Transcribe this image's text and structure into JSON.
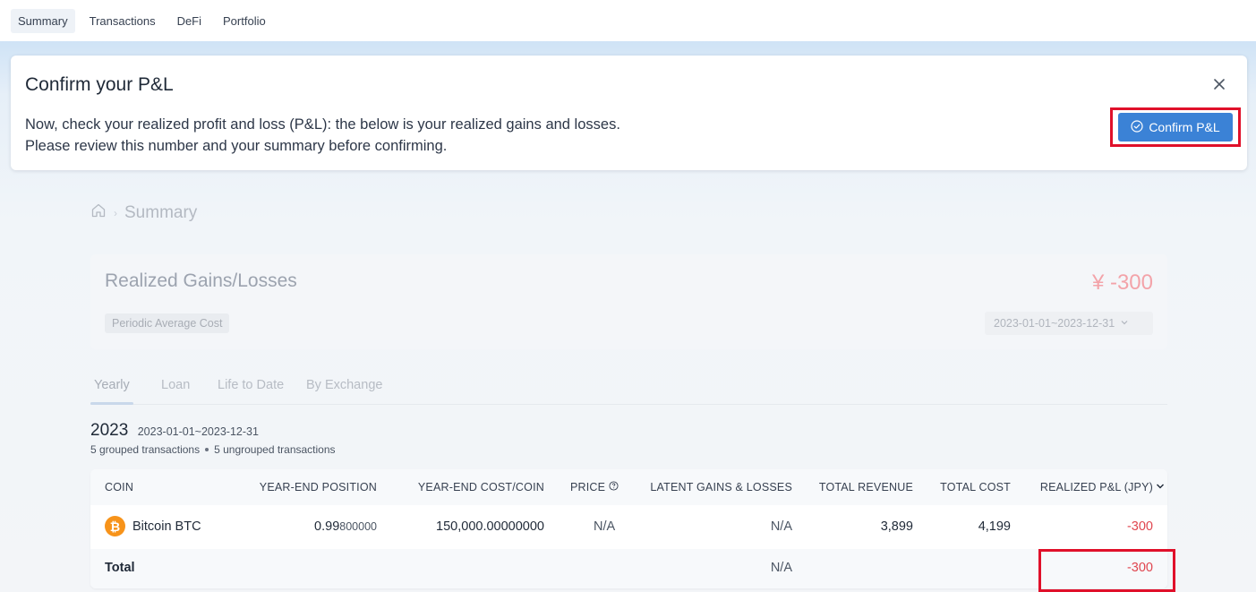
{
  "nav": {
    "tabs": [
      {
        "label": "Summary",
        "active": true
      },
      {
        "label": "Transactions",
        "active": false
      },
      {
        "label": "DeFi",
        "active": false
      },
      {
        "label": "Portfolio",
        "active": false
      }
    ]
  },
  "banner": {
    "title": "Confirm your P&L",
    "line1": "Now, check your realized profit and loss (P&L): the below is your realized gains and losses.",
    "line2": "Please review this number and your summary before confirming.",
    "confirm_label": "Confirm P&L",
    "close_icon": "close-icon"
  },
  "breadcrumb": {
    "home_icon": "home-icon",
    "current": "Summary"
  },
  "gains": {
    "title": "Realized Gains/Losses",
    "value": "¥ -300",
    "method": "Periodic Average Cost",
    "date_range": "2023-01-01~2023-12-31"
  },
  "subtabs": [
    {
      "label": "Yearly",
      "active": true
    },
    {
      "label": "Loan",
      "active": false
    },
    {
      "label": "Life to Date",
      "active": false
    },
    {
      "label": "By Exchange",
      "active": false
    }
  ],
  "year": {
    "year": "2023",
    "range": "2023-01-01~2023-12-31",
    "grouped": "5 grouped transactions",
    "ungrouped": "5 ungrouped transactions"
  },
  "table": {
    "headers": {
      "coin": "COIN",
      "position": "YEAR-END POSITION",
      "cost_coin": "YEAR-END COST/COIN",
      "price": "PRICE",
      "latent": "LATENT GAINS & LOSSES",
      "revenue": "TOTAL REVENUE",
      "cost": "TOTAL COST",
      "pnl": "REALIZED P&L (JPY)"
    },
    "rows": [
      {
        "coin": "Bitcoin BTC",
        "position_main": "0.99",
        "position_rest": "800000",
        "cost_coin": "150,000.00000000",
        "price": "N/A",
        "latent": "N/A",
        "revenue": "3,899",
        "cost": "4,199",
        "pnl": "-300"
      }
    ],
    "total": {
      "label": "Total",
      "latent": "N/A",
      "pnl": "-300"
    }
  },
  "colors": {
    "accent": "#3b82d6",
    "negative": "#e0464f",
    "highlight": "#e0102a",
    "bitcoin": "#f7931a"
  }
}
